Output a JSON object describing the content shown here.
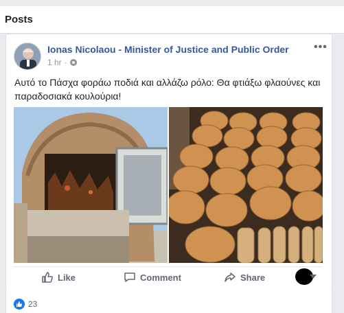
{
  "section": {
    "title": "Posts"
  },
  "post": {
    "author": "Ionas Nicolaou - Minister of Justice and Public Order",
    "time": "1 hr",
    "more_label": "•••",
    "text": "Αυτό το Πάσχα φοράω ποδιά και αλλάζω ρόλο: Θα φτιάξω φλαούνες και παραδοσιακά κουλούρια!",
    "photos": [
      {
        "name": "stone-oven-photo"
      },
      {
        "name": "baked-pastries-photo"
      }
    ]
  },
  "actions": {
    "like_label": "Like",
    "comment_label": "Comment",
    "share_label": "Share"
  },
  "reactions": {
    "count": "23"
  },
  "colors": {
    "link_blue": "#365899",
    "muted": "#90949c",
    "background": "#e9ebee",
    "like_blue": "#1877f2"
  },
  "icons": [
    "globe-icon",
    "more-icon",
    "like-icon",
    "comment-icon",
    "share-icon",
    "like-reaction-icon",
    "audience-caret-icon"
  ]
}
